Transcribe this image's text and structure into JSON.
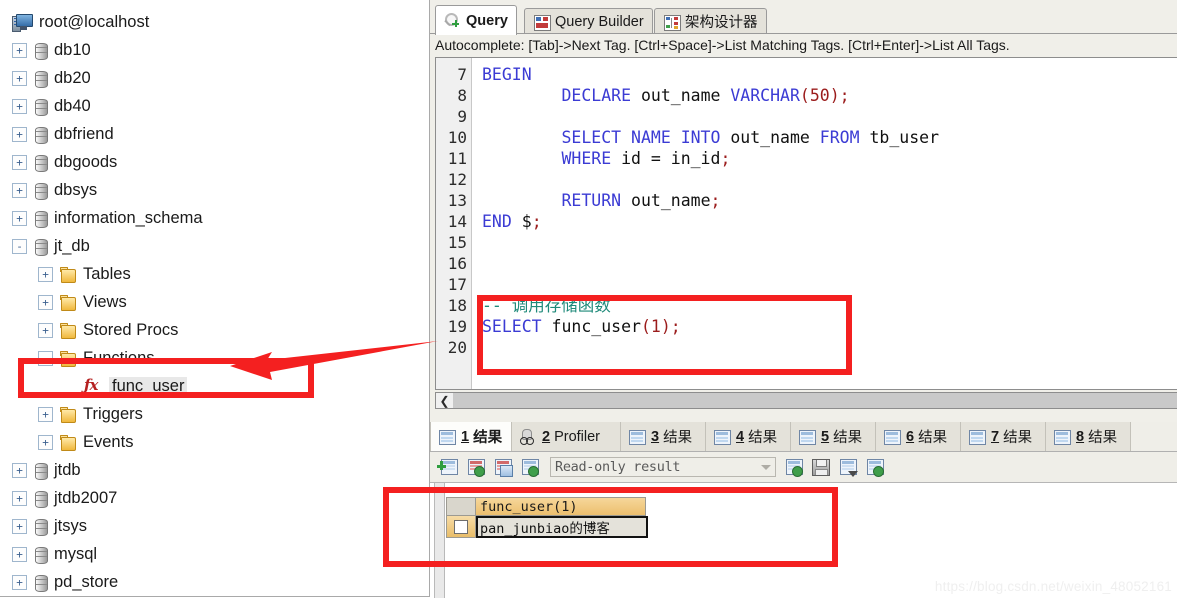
{
  "sidebar": {
    "root": {
      "label": "root@localhost",
      "icon": "server-icon"
    },
    "items": [
      {
        "label": "db10",
        "icon": "database-icon",
        "expander": "+",
        "indent": 0
      },
      {
        "label": "db20",
        "icon": "database-icon",
        "expander": "+",
        "indent": 0
      },
      {
        "label": "db40",
        "icon": "database-icon",
        "expander": "+",
        "indent": 0
      },
      {
        "label": "dbfriend",
        "icon": "database-icon",
        "expander": "+",
        "indent": 0
      },
      {
        "label": "dbgoods",
        "icon": "database-icon",
        "expander": "+",
        "indent": 0
      },
      {
        "label": "dbsys",
        "icon": "database-icon",
        "expander": "+",
        "indent": 0
      },
      {
        "label": "information_schema",
        "icon": "database-icon",
        "expander": "+",
        "indent": 0
      },
      {
        "label": "jt_db",
        "icon": "database-icon",
        "expander": "-",
        "indent": 0
      },
      {
        "label": "Tables",
        "icon": "folder-icon",
        "expander": "+",
        "indent": 1
      },
      {
        "label": "Views",
        "icon": "folder-icon",
        "expander": "+",
        "indent": 1
      },
      {
        "label": "Stored Procs",
        "icon": "folder-icon",
        "expander": "+",
        "indent": 1
      },
      {
        "label": "Functions",
        "icon": "folder-icon",
        "expander": "-",
        "indent": 1
      },
      {
        "label": "func_user",
        "icon": "function-icon",
        "expander": "",
        "indent": 2,
        "selected": true
      },
      {
        "label": "Triggers",
        "icon": "folder-icon",
        "expander": "+",
        "indent": 1
      },
      {
        "label": "Events",
        "icon": "folder-icon",
        "expander": "+",
        "indent": 1
      },
      {
        "label": "jtdb",
        "icon": "database-icon",
        "expander": "+",
        "indent": 0
      },
      {
        "label": "jtdb2007",
        "icon": "database-icon",
        "expander": "+",
        "indent": 0
      },
      {
        "label": "jtsys",
        "icon": "database-icon",
        "expander": "+",
        "indent": 0
      },
      {
        "label": "mysql",
        "icon": "database-icon",
        "expander": "+",
        "indent": 0
      },
      {
        "label": "pd_store",
        "icon": "database-icon",
        "expander": "+",
        "indent": 0
      }
    ]
  },
  "editor_tabs": [
    {
      "label": "Query",
      "icon": "query-icon",
      "active": true
    },
    {
      "label": "Query Builder",
      "icon": "query-builder-icon",
      "active": false
    },
    {
      "label": "架构设计器",
      "icon": "schema-designer-icon",
      "active": false
    }
  ],
  "autocomplete_hint": "Autocomplete: [Tab]->Next Tag. [Ctrl+Space]->List Matching Tags. [Ctrl+Enter]->List All Tags.",
  "code": {
    "first_line_number": 7,
    "lines": [
      {
        "n": 7,
        "tokens": [
          {
            "t": "BEGIN",
            "c": "kw"
          }
        ]
      },
      {
        "n": 8,
        "tokens": [
          {
            "t": "        ",
            "c": ""
          },
          {
            "t": "DECLARE",
            "c": "kw"
          },
          {
            "t": " out_name ",
            "c": ""
          },
          {
            "t": "VARCHAR",
            "c": "kw"
          },
          {
            "t": "(",
            "c": "pun"
          },
          {
            "t": "50",
            "c": "num"
          },
          {
            "t": ")",
            "c": "pun"
          },
          {
            "t": ";",
            "c": "pun"
          }
        ]
      },
      {
        "n": 9,
        "tokens": []
      },
      {
        "n": 10,
        "tokens": [
          {
            "t": "        ",
            "c": ""
          },
          {
            "t": "SELECT NAME INTO",
            "c": "kw"
          },
          {
            "t": " out_name ",
            "c": ""
          },
          {
            "t": "FROM",
            "c": "kw"
          },
          {
            "t": " tb_user",
            "c": ""
          }
        ]
      },
      {
        "n": 11,
        "tokens": [
          {
            "t": "        ",
            "c": ""
          },
          {
            "t": "WHERE",
            "c": "kw"
          },
          {
            "t": " id = in_id",
            "c": ""
          },
          {
            "t": ";",
            "c": "pun"
          }
        ]
      },
      {
        "n": 12,
        "tokens": []
      },
      {
        "n": 13,
        "tokens": [
          {
            "t": "        ",
            "c": ""
          },
          {
            "t": "RETURN",
            "c": "kw"
          },
          {
            "t": " out_name",
            "c": ""
          },
          {
            "t": ";",
            "c": "pun"
          }
        ]
      },
      {
        "n": 14,
        "tokens": [
          {
            "t": "END",
            "c": "kw"
          },
          {
            "t": " $",
            "c": ""
          },
          {
            "t": ";",
            "c": "pun"
          }
        ]
      },
      {
        "n": 15,
        "tokens": []
      },
      {
        "n": 16,
        "tokens": []
      },
      {
        "n": 17,
        "tokens": []
      },
      {
        "n": 18,
        "tokens": [
          {
            "t": "-- 调用存储函数",
            "c": "cmt"
          }
        ]
      },
      {
        "n": 19,
        "tokens": [
          {
            "t": "SELECT",
            "c": "kw"
          },
          {
            "t": " func_user",
            "c": ""
          },
          {
            "t": "(",
            "c": "pun"
          },
          {
            "t": "1",
            "c": "num"
          },
          {
            "t": ")",
            "c": "pun"
          },
          {
            "t": ";",
            "c": "pun"
          }
        ]
      },
      {
        "n": 20,
        "tokens": []
      }
    ]
  },
  "result_tabs": [
    {
      "label": "结果",
      "num": "1",
      "icon": "grid-icon",
      "active": true
    },
    {
      "label": "Profiler",
      "num": "2",
      "icon": "profiler-icon",
      "active": false
    },
    {
      "label": "结果",
      "num": "3",
      "icon": "grid-icon",
      "active": false
    },
    {
      "label": "结果",
      "num": "4",
      "icon": "grid-icon",
      "active": false
    },
    {
      "label": "结果",
      "num": "5",
      "icon": "grid-icon",
      "active": false
    },
    {
      "label": "结果",
      "num": "6",
      "icon": "grid-icon",
      "active": false
    },
    {
      "label": "结果",
      "num": "7",
      "icon": "grid-icon",
      "active": false
    },
    {
      "label": "结果",
      "num": "8",
      "icon": "grid-icon",
      "active": false
    }
  ],
  "result_toolbar": {
    "mode_value": "Read-only result",
    "buttons": [
      {
        "name": "new-row-button"
      },
      {
        "name": "insert-row-button"
      },
      {
        "name": "duplicate-row-button"
      },
      {
        "name": "apply-changes-button"
      },
      {
        "name": "export-grid-button"
      },
      {
        "name": "save-result-button"
      },
      {
        "name": "grid-options-button"
      },
      {
        "name": "grid-filter-button"
      }
    ]
  },
  "result_grid": {
    "columns": [
      "func_user(1)"
    ],
    "rows": [
      {
        "checked": false,
        "values": [
          "pan_junbiao的博客"
        ]
      }
    ]
  },
  "watermark": "https://blog.csdn.net/weixin_48052161",
  "colors": {
    "annotation_red": "#f42020",
    "keyword_blue": "#3b3bd4",
    "comment_teal": "#1f8a7a",
    "literal_red": "#9b1c1c",
    "grid_header_orange": "#ecbf6e"
  }
}
